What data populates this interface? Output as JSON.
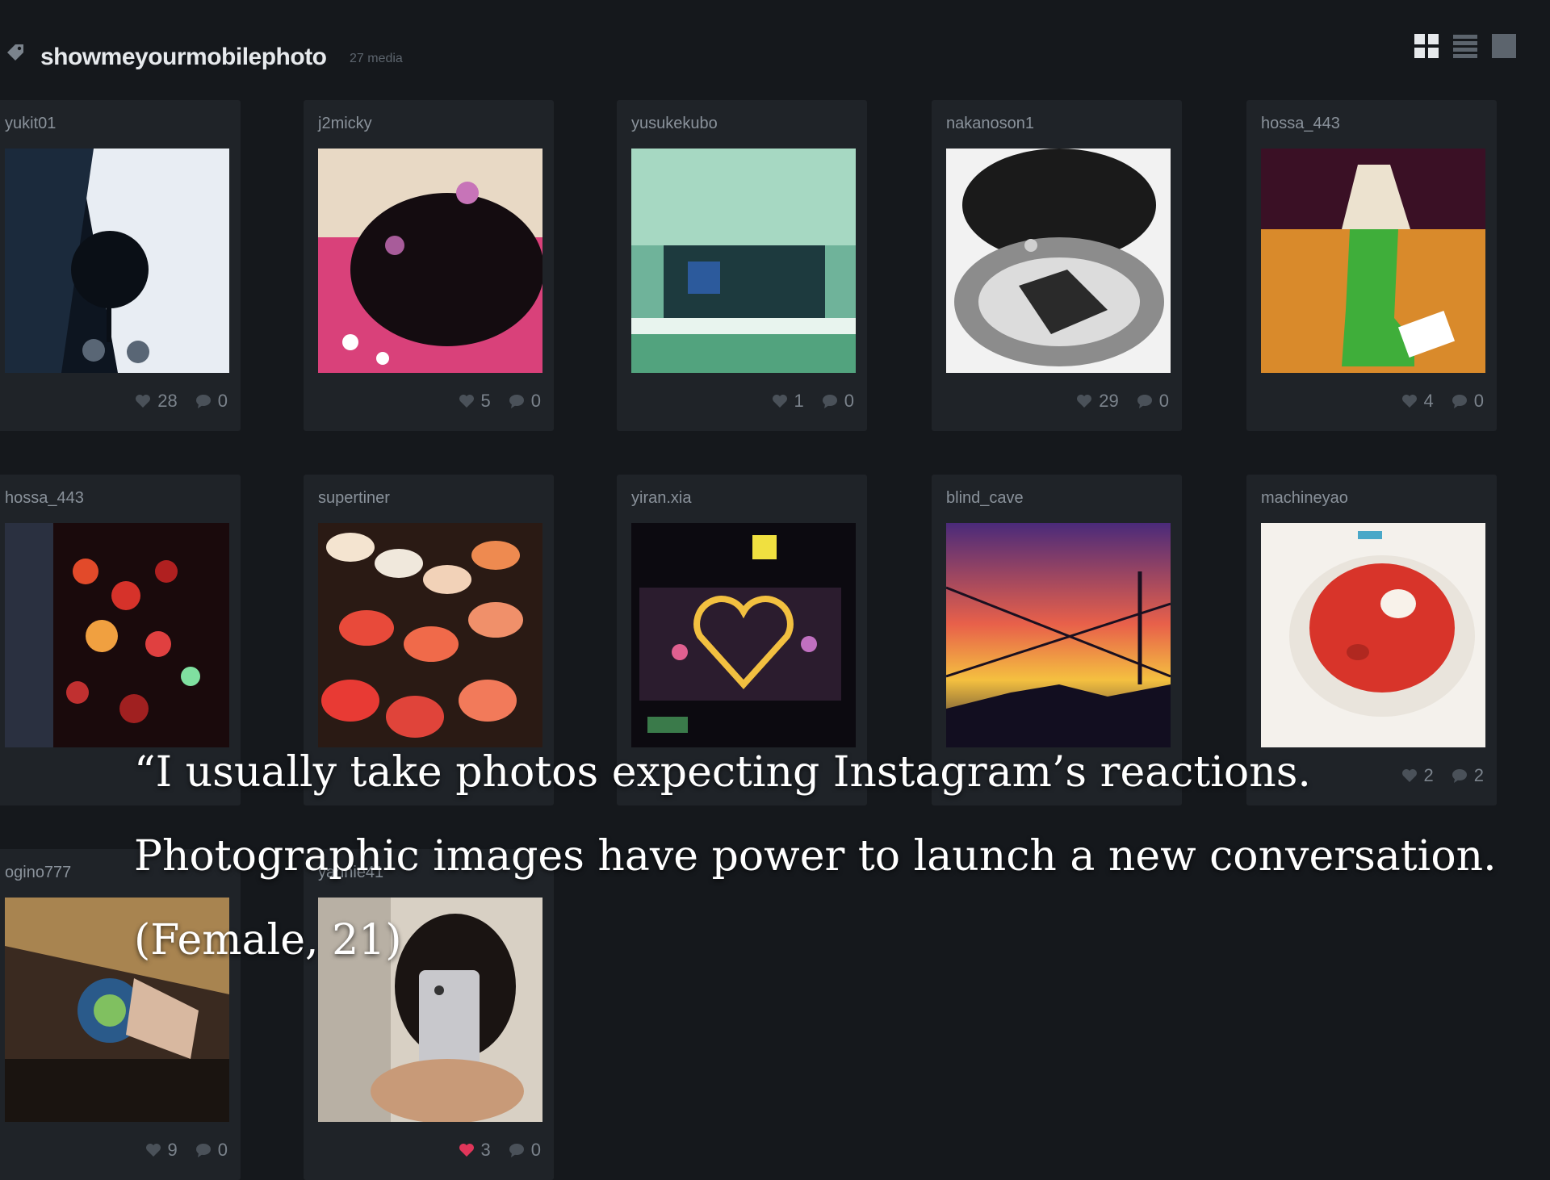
{
  "header": {
    "title": "showmeyourmobilephoto",
    "count": "27 media",
    "views": [
      "grid-view",
      "list-view",
      "single-view"
    ]
  },
  "cards": [
    {
      "user": "yukit01",
      "likes": "28",
      "comments": "0",
      "liked": false,
      "photo": "snowy-night-umbrella"
    },
    {
      "user": "j2micky",
      "likes": "5",
      "comments": "0",
      "liked": false,
      "photo": "doll-hair-bow"
    },
    {
      "user": "yusukekubo",
      "likes": "1",
      "comments": "0",
      "liked": false,
      "photo": "stadium-green"
    },
    {
      "user": "nakanoson1",
      "likes": "29",
      "comments": "0",
      "liked": false,
      "photo": "helmet-reflection-bw"
    },
    {
      "user": "hossa_443",
      "likes": "4",
      "comments": "0",
      "liked": false,
      "photo": "melon-soda-float"
    },
    {
      "user": "hossa_443",
      "likes": "",
      "comments": "",
      "liked": false,
      "photo": "red-lanterns"
    },
    {
      "user": "supertiner",
      "likes": "",
      "comments": "",
      "liked": false,
      "photo": "sushi-platter"
    },
    {
      "user": "yiran.xia",
      "likes": "",
      "comments": "",
      "liked": false,
      "photo": "heart-billboard"
    },
    {
      "user": "blind_cave",
      "likes": "",
      "comments": "",
      "liked": false,
      "photo": "sunset-wires"
    },
    {
      "user": "machineyao",
      "likes": "2",
      "comments": "2",
      "liked": false,
      "photo": "tomato-soup"
    },
    {
      "user": "ogino777",
      "likes": "9",
      "comments": "0",
      "liked": false,
      "photo": "room-tilted"
    },
    {
      "user": "yannie41",
      "likes": "3",
      "comments": "0",
      "liked": true,
      "photo": "phone-selfie"
    }
  ],
  "quote": {
    "line1": "“I usually take photos expecting Instagram’s reactions.",
    "line2": "Photographic images have power to launch a new conversation.",
    "line3": "(Female, 21)"
  },
  "colors": {
    "background": "#15181c",
    "card": "#1f2328",
    "liked_heart": "#e0365a"
  }
}
